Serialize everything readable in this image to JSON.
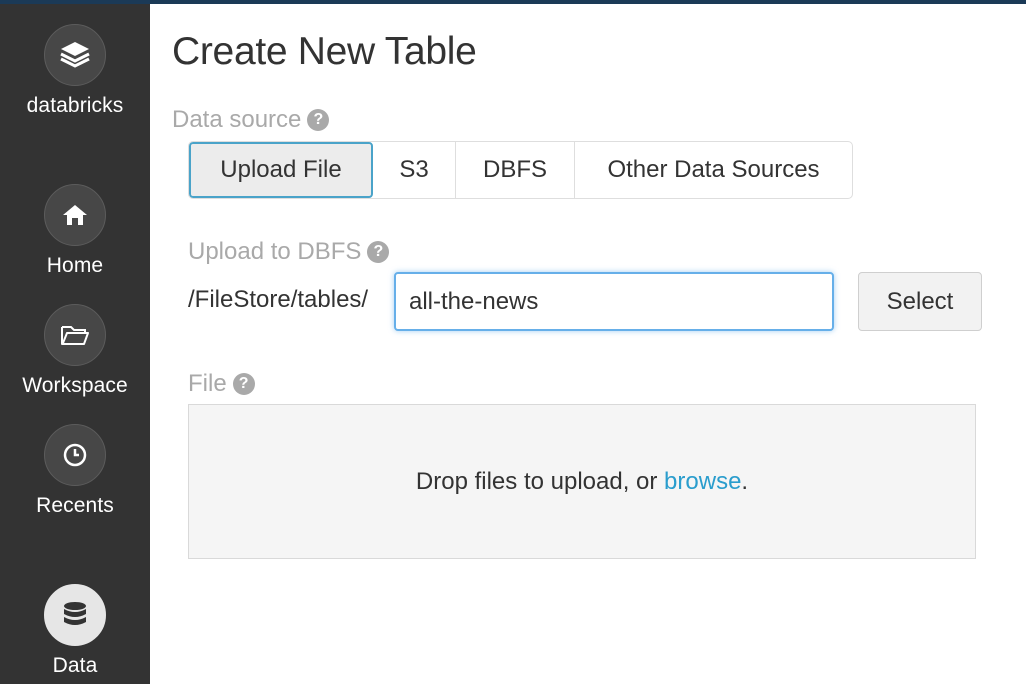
{
  "sidebar": {
    "brand": "databricks",
    "items": [
      {
        "label": "Home",
        "icon": "home-icon"
      },
      {
        "label": "Workspace",
        "icon": "folder-icon"
      },
      {
        "label": "Recents",
        "icon": "clock-icon"
      },
      {
        "label": "Data",
        "icon": "database-icon",
        "active": true
      }
    ]
  },
  "main": {
    "title": "Create New Table",
    "data_source": {
      "label": "Data source",
      "tabs": [
        "Upload File",
        "S3",
        "DBFS",
        "Other Data Sources"
      ],
      "active": "Upload File"
    },
    "upload": {
      "label": "Upload to DBFS",
      "path_prefix": "/FileStore/tables/",
      "input_value": "all-the-news",
      "select_label": "Select"
    },
    "file": {
      "label": "File",
      "drop_text": "Drop files to upload, or ",
      "browse_label": "browse",
      "period": "."
    }
  },
  "colors": {
    "sidebar_bg": "#333333",
    "accent": "#2a9dcd",
    "focus_border": "#66afe9",
    "topbar": "#1b3a57"
  }
}
